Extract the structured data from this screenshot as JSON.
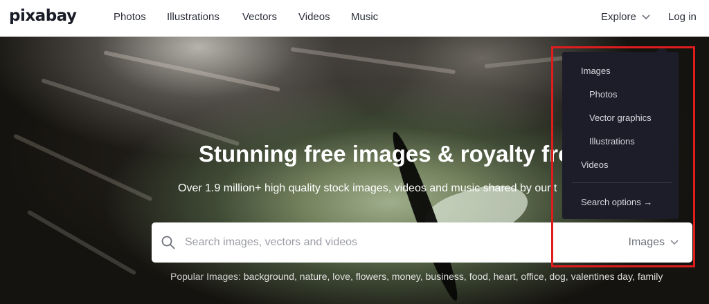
{
  "brand": {
    "logo": "pixabay"
  },
  "nav": {
    "links": [
      "Photos",
      "Illustrations",
      "Vectors",
      "Videos",
      "Music"
    ],
    "explore_label": "Explore",
    "login_label": "Log in"
  },
  "hero": {
    "title": "Stunning free images & royalty fre",
    "subtitle": "Over 1.9 million+ high quality stock images, videos and music shared by our t",
    "search": {
      "placeholder": "Search images, vectors and videos",
      "type_label": "Images"
    },
    "popular_label": "Popular Images:",
    "popular_tags": [
      "background,",
      "nature,",
      "love,",
      "flowers,",
      "money,",
      "business,",
      "food,",
      "heart,",
      "office,",
      "dog,",
      "valentines day,",
      "family"
    ]
  },
  "explore_menu": {
    "images_label": "Images",
    "photos_label": "Photos",
    "vectors_label": "Vector graphics",
    "illustrations_label": "Illustrations",
    "videos_label": "Videos",
    "search_options_label": "Search options →"
  },
  "colors": {
    "menu_bg": "#1c1d29",
    "highlight": "#e01d1d",
    "text_dark": "#2c2f3b"
  }
}
